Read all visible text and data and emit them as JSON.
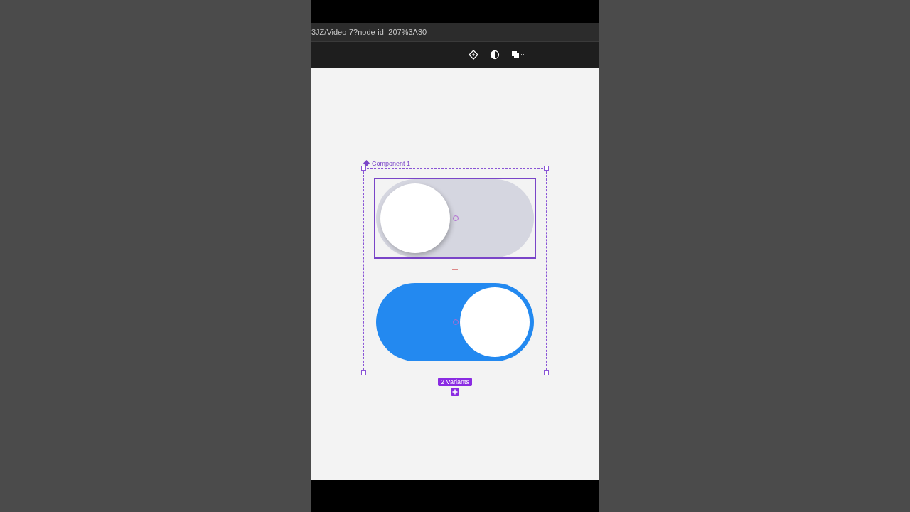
{
  "address_bar": {
    "url": "3JZ/Video-7?node-id=207%3A30"
  },
  "component": {
    "label": "Component 1",
    "variants_badge": "2 Variants"
  },
  "toggles": [
    {
      "on": false
    },
    {
      "on": true
    }
  ]
}
